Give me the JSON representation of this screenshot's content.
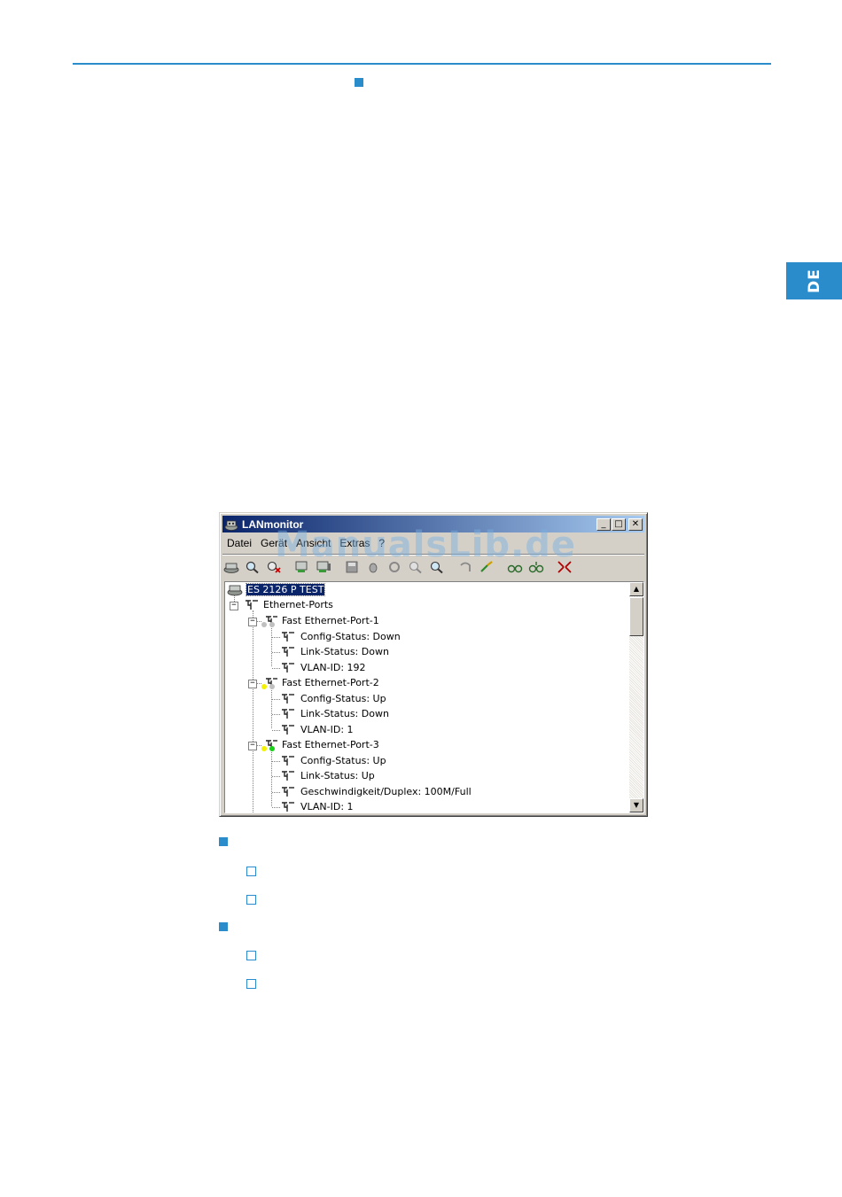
{
  "side_tab": {
    "label": "DE"
  },
  "window": {
    "title": "LANmonitor",
    "title_icon": "lanmonitor-app-icon",
    "controls": {
      "minimize": "_",
      "maximize": "□",
      "close": "✕"
    },
    "menu": [
      "Datei",
      "Gerät",
      "Ansicht",
      "Extras",
      "?"
    ],
    "toolbar_icons": [
      "device-icon",
      "search-icon",
      "delete-icon",
      "monitor-add-icon",
      "monitor-icon",
      "save-icon",
      "print-icon",
      "refresh-icon",
      "zoom-icon",
      "find-icon",
      "undo-icon",
      "connect-icon",
      "glasses-icon",
      "glasses-icon-2",
      "collapse-icon"
    ]
  },
  "tree": {
    "root": "ES 2126 P TEST",
    "group": "Ethernet-Ports",
    "ports": [
      {
        "label": "Fast Ethernet-Port-1",
        "led_left": "#c0c0c0",
        "led_right": "#c0c0c0",
        "children": [
          "Config-Status: Down",
          "Link-Status: Down",
          "VLAN-ID: 192"
        ]
      },
      {
        "label": "Fast Ethernet-Port-2",
        "led_left": "#f2f200",
        "led_right": "#c0c0c0",
        "children": [
          "Config-Status: Up",
          "Link-Status: Down",
          "VLAN-ID: 1"
        ]
      },
      {
        "label": "Fast Ethernet-Port-3",
        "led_left": "#f2f200",
        "led_right": "#18d018",
        "children": [
          "Config-Status: Up",
          "Link-Status: Up",
          "Geschwindigkeit/Duplex: 100M/Full",
          "VLAN-ID: 1"
        ]
      }
    ]
  },
  "scrollbar": {
    "up": "▲",
    "down": "▼"
  },
  "watermark": "ManualsLib.de",
  "colors": {
    "accent": "#2a8ccb",
    "selection": "#0a246a"
  }
}
